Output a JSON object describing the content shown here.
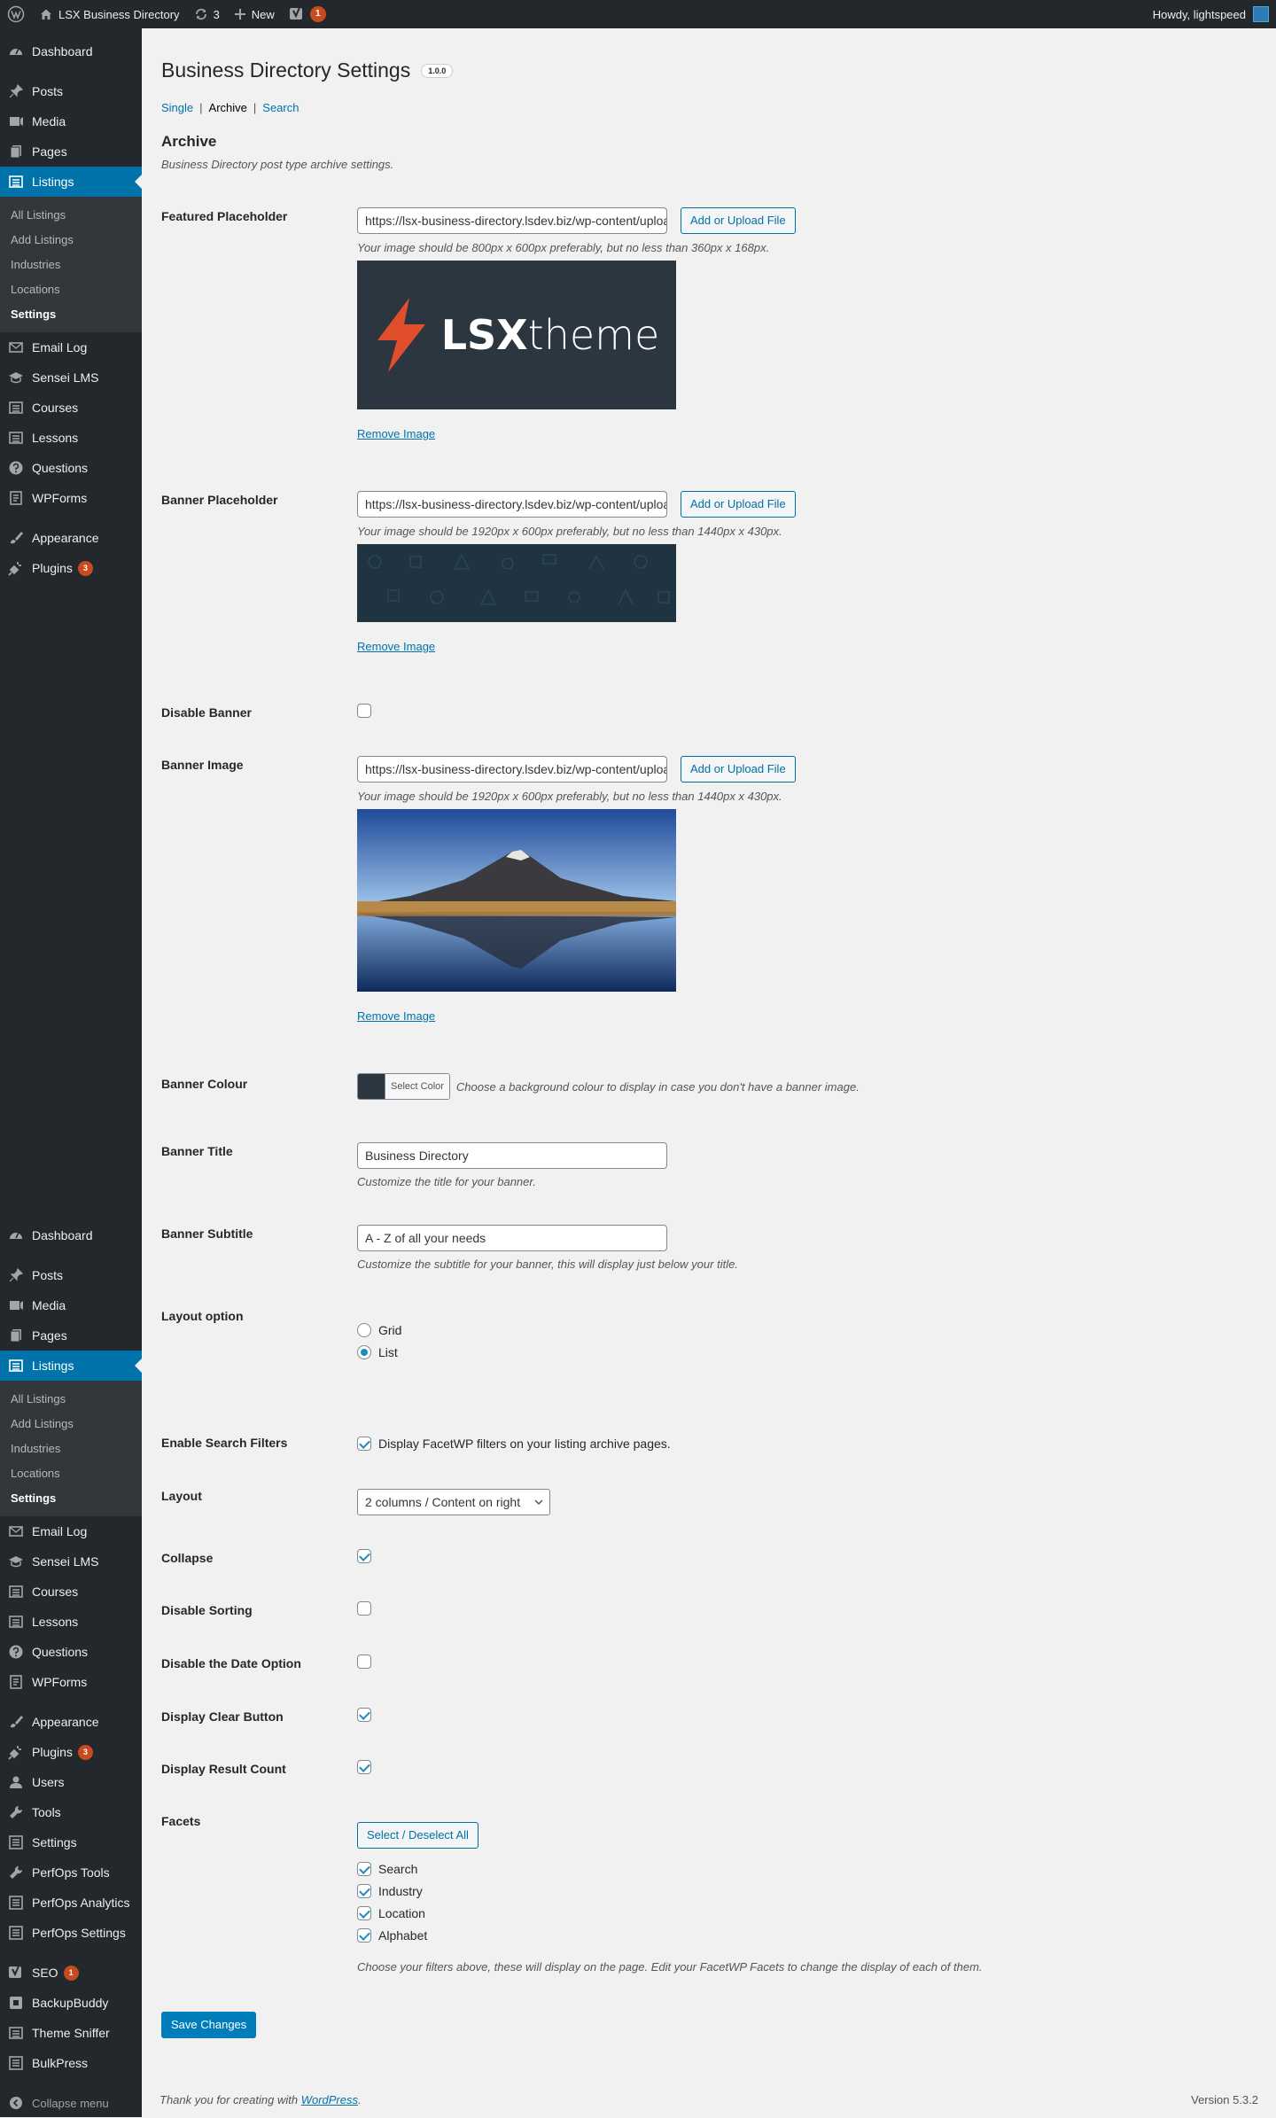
{
  "admin_bar": {
    "site_name": "LSX Business Directory",
    "updates_count": "3",
    "new_label": "New",
    "yoast_badge": "1",
    "greeting": "Howdy, lightspeed"
  },
  "sidebar": {
    "top": {
      "main_items": [
        {
          "label": "Dashboard",
          "icon": "dashboard-icon"
        },
        {
          "label": "Posts",
          "icon": "pin-icon"
        },
        {
          "label": "Media",
          "icon": "media-icon"
        },
        {
          "label": "Pages",
          "icon": "page-icon"
        },
        {
          "label": "Listings",
          "icon": "list-icon"
        }
      ],
      "submenu": [
        "All Listings",
        "Add Listings",
        "Industries",
        "Locations",
        "Settings"
      ],
      "after_items": [
        {
          "label": "Email Log",
          "icon": "email-icon"
        },
        {
          "label": "Sensei LMS",
          "icon": "graduation-icon"
        },
        {
          "label": "Courses",
          "icon": "list-icon"
        },
        {
          "label": "Lessons",
          "icon": "list-icon"
        },
        {
          "label": "Questions",
          "icon": "question-icon"
        },
        {
          "label": "WPForms",
          "icon": "form-icon"
        },
        {
          "label": "Appearance",
          "icon": "brush-icon"
        },
        {
          "label": "Plugins",
          "icon": "plugin-icon",
          "badge": "3"
        }
      ]
    },
    "bottom": {
      "main_items": [
        {
          "label": "Dashboard",
          "icon": "dashboard-icon"
        },
        {
          "label": "Posts",
          "icon": "pin-icon"
        },
        {
          "label": "Media",
          "icon": "media-icon"
        },
        {
          "label": "Pages",
          "icon": "page-icon"
        },
        {
          "label": "Listings",
          "icon": "list-icon"
        }
      ],
      "submenu": [
        "All Listings",
        "Add Listings",
        "Industries",
        "Locations",
        "Settings"
      ],
      "after_items": [
        {
          "label": "Email Log",
          "icon": "email-icon"
        },
        {
          "label": "Sensei LMS",
          "icon": "graduation-icon"
        },
        {
          "label": "Courses",
          "icon": "list-icon"
        },
        {
          "label": "Lessons",
          "icon": "list-icon"
        },
        {
          "label": "Questions",
          "icon": "question-icon"
        },
        {
          "label": "WPForms",
          "icon": "form-icon"
        },
        {
          "label": "Appearance",
          "icon": "brush-icon"
        },
        {
          "label": "Plugins",
          "icon": "plugin-icon",
          "badge": "3"
        },
        {
          "label": "Users",
          "icon": "users-icon"
        },
        {
          "label": "Tools",
          "icon": "wrench-icon"
        },
        {
          "label": "Settings",
          "icon": "settings-icon"
        },
        {
          "label": "PerfOps Tools",
          "icon": "wrench-icon"
        },
        {
          "label": "PerfOps Analytics",
          "icon": "settings-icon"
        },
        {
          "label": "PerfOps Settings",
          "icon": "settings-icon"
        },
        {
          "label": "SEO",
          "icon": "yoast-icon",
          "badge": "1"
        },
        {
          "label": "BackupBuddy",
          "icon": "backup-icon"
        },
        {
          "label": "Theme Sniffer",
          "icon": "list-icon"
        },
        {
          "label": "BulkPress",
          "icon": "settings-icon"
        }
      ],
      "collapse_label": "Collapse menu"
    }
  },
  "page": {
    "title": "Business Directory Settings",
    "version": "1.0.0",
    "tabs": {
      "single": "Single",
      "archive": "Archive",
      "search": "Search"
    },
    "section_title": "Archive",
    "section_desc": "Business Directory post type archive settings."
  },
  "fields": {
    "featured_placeholder": {
      "label": "Featured Placeholder",
      "value": "https://lsx-business-directory.lsdev.biz/wp-content/uploads/",
      "button": "Add or Upload File",
      "desc": "Your image should be 800px x 600px preferably, but no less than 360px x 168px.",
      "logo_bold": "LSX",
      "logo_light": "theme",
      "remove": "Remove Image"
    },
    "banner_placeholder": {
      "label": "Banner Placeholder",
      "value": "https://lsx-business-directory.lsdev.biz/wp-content/uploads/",
      "button": "Add or Upload File",
      "desc": "Your image should be 1920px x 600px preferably, but no less than 1440px x 430px.",
      "remove": "Remove Image"
    },
    "disable_banner": {
      "label": "Disable Banner",
      "checked": false
    },
    "banner_image": {
      "label": "Banner Image",
      "value": "https://lsx-business-directory.lsdev.biz/wp-content/uploads/",
      "button": "Add or Upload File",
      "desc": "Your image should be 1920px x 600px preferably, but no less than 1440px x 430px.",
      "remove": "Remove Image"
    },
    "banner_colour": {
      "label": "Banner Colour",
      "button": "Select Color",
      "swatch": "#2b3640",
      "desc": "Choose a background colour to display in case you don't have a banner image."
    },
    "banner_title": {
      "label": "Banner Title",
      "value": "Business Directory",
      "desc": "Customize the title for your banner."
    },
    "banner_subtitle": {
      "label": "Banner Subtitle",
      "value": "A - Z of all your needs",
      "desc": "Customize the subtitle for your banner, this will display just below your title."
    },
    "layout_option": {
      "label": "Layout option",
      "options": [
        {
          "label": "Grid",
          "checked": false
        },
        {
          "label": "List",
          "checked": true
        }
      ]
    },
    "enable_search_filters": {
      "label": "Enable Search Filters",
      "checkbox_label": "Display FacetWP filters on your listing archive pages.",
      "checked": true
    },
    "layout": {
      "label": "Layout",
      "selected": "2 columns / Content on right"
    },
    "collapse": {
      "label": "Collapse",
      "checked": true
    },
    "disable_sorting": {
      "label": "Disable Sorting",
      "checked": false
    },
    "disable_date": {
      "label": "Disable the Date Option",
      "checked": false
    },
    "display_clear": {
      "label": "Display Clear Button",
      "checked": true
    },
    "display_result_count": {
      "label": "Display Result Count",
      "checked": true
    },
    "facets": {
      "label": "Facets",
      "button": "Select / Deselect All",
      "items": [
        {
          "label": "Search",
          "checked": true
        },
        {
          "label": "Industry",
          "checked": true
        },
        {
          "label": "Location",
          "checked": true
        },
        {
          "label": "Alphabet",
          "checked": true
        }
      ],
      "desc": "Choose your filters above, these will display on the page. Edit your FacetWP Facets to change the display of each of them."
    }
  },
  "save_button": "Save Changes",
  "footer": {
    "text_before": "Thank you for creating with ",
    "link": "WordPress",
    "text_after": ".",
    "version": "Version 5.3.2"
  },
  "colors": {
    "admin_bar": "#23282d",
    "sidebar": "#23282d",
    "submenu": "#32373c",
    "accent": "#0073aa",
    "badge": "#ca4a1f",
    "logo_bg": "#2b3640",
    "logo_bolt": "#e04e2b"
  }
}
